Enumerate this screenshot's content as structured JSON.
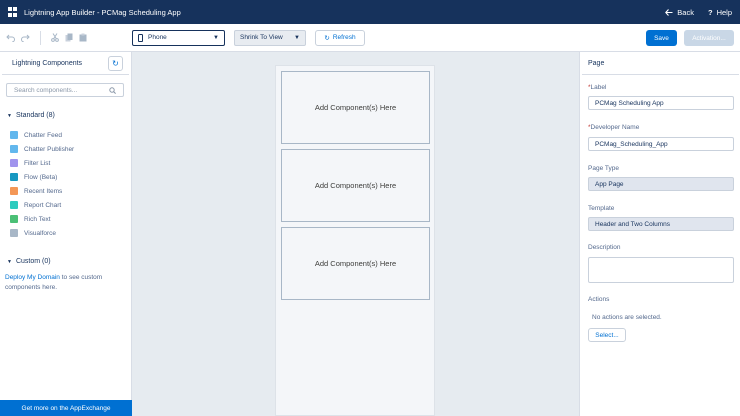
{
  "topbar": {
    "title": "Lightning App Builder - PCMag Scheduling App",
    "back_label": "Back",
    "help_label": "Help"
  },
  "toolbar": {
    "device": "Phone",
    "view": "Shrink To View",
    "refresh_label": "Refresh",
    "save_label": "Save",
    "activation_label": "Activation..."
  },
  "left_panel": {
    "title": "Lightning Components",
    "search_placeholder": "Search components...",
    "standard_label": "Standard (8)",
    "components": [
      {
        "label": "Chatter Feed",
        "icon": "chatter-feed-icon",
        "color": "#62b7ed"
      },
      {
        "label": "Chatter Publisher",
        "icon": "chatter-publisher-icon",
        "color": "#62b7ed"
      },
      {
        "label": "Filter List",
        "icon": "filter-list-icon",
        "color": "#a094ed"
      },
      {
        "label": "Flow (Beta)",
        "icon": "flow-icon",
        "color": "#1798c1"
      },
      {
        "label": "Recent Items",
        "icon": "recent-items-icon",
        "color": "#f49756"
      },
      {
        "label": "Report Chart",
        "icon": "report-chart-icon",
        "color": "#2ecbbe"
      },
      {
        "label": "Rich Text",
        "icon": "rich-text-icon",
        "color": "#4bc076"
      },
      {
        "label": "Visualforce",
        "icon": "visualforce-icon",
        "color": "#a8b7c7"
      }
    ],
    "custom_label": "Custom (0)",
    "custom_note_link": "Deploy My Domain",
    "custom_note_rest": " to see custom components here.",
    "appexchange_label": "Get more on the AppExchange"
  },
  "canvas": {
    "slots": [
      "Add Component(s) Here",
      "Add Component(s) Here",
      "Add Component(s) Here"
    ]
  },
  "properties": {
    "title": "Page",
    "label_label": "Label",
    "label_value": "PCMag Scheduling App",
    "devname_label": "Developer Name",
    "devname_value": "PCMag_Scheduling_App",
    "pagetype_label": "Page Type",
    "pagetype_value": "App Page",
    "template_label": "Template",
    "template_value": "Header and Two Columns",
    "description_label": "Description",
    "description_value": "",
    "actions_label": "Actions",
    "actions_note": "No actions are selected.",
    "select_label": "Select..."
  }
}
